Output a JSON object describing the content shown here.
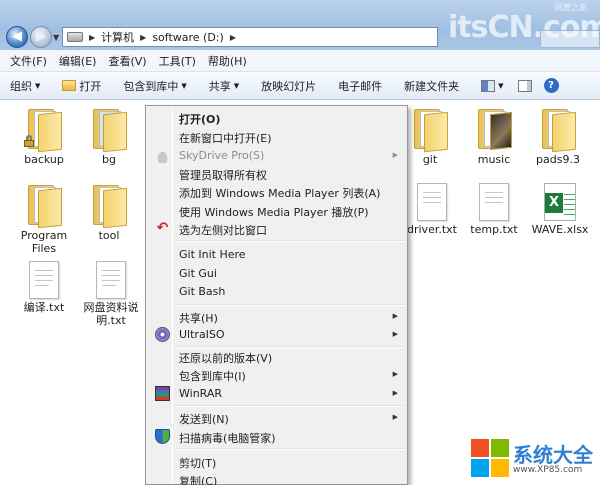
{
  "address": {
    "segments": [
      "计算机",
      "software (D:)"
    ]
  },
  "watermark": {
    "text": "itsCN.com",
    "tiny": "网管之家"
  },
  "menubar": [
    "文件(F)",
    "编辑(E)",
    "查看(V)",
    "工具(T)",
    "帮助(H)"
  ],
  "commandbar": {
    "organize": "组织",
    "open": "打开",
    "include": "包含到库中",
    "share": "共享",
    "slideshow": "放映幻灯片",
    "email": "电子邮件",
    "new_folder": "新建文件夹"
  },
  "files": [
    {
      "name": "backup",
      "type": "folder-locked"
    },
    {
      "name": "bg",
      "type": "folder"
    },
    {
      "name": "Program Files",
      "type": "folder"
    },
    {
      "name": "tool",
      "type": "folder"
    },
    {
      "name": "编译.txt",
      "type": "txt"
    },
    {
      "name": "网盘资料说明.txt",
      "type": "txt"
    },
    {
      "name": "git",
      "type": "folder"
    },
    {
      "name": "music",
      "type": "folder-music"
    },
    {
      "name": "pads9.3",
      "type": "folder"
    },
    {
      "name": "driver.txt",
      "type": "txt"
    },
    {
      "name": "temp.txt",
      "type": "txt"
    },
    {
      "name": "WAVE.xlsx",
      "type": "xlsx"
    }
  ],
  "context_menu": [
    {
      "label": "打开(O)",
      "bold": true
    },
    {
      "label": "在新窗口中打开(E)"
    },
    {
      "label": "SkyDrive Pro(S)",
      "disabled": true,
      "submenu": true,
      "icon": "cloud-icon"
    },
    {
      "label": "管理员取得所有权"
    },
    {
      "label": "添加到 Windows Media Player 列表(A)"
    },
    {
      "label": "使用 Windows Media Player 播放(P)"
    },
    {
      "label": "选为左侧对比窗口",
      "icon": "undo-arrow-icon"
    },
    {
      "label": "Git Init Here"
    },
    {
      "label": "Git Gui"
    },
    {
      "label": "Git Bash"
    },
    {
      "label": "共享(H)",
      "submenu": true
    },
    {
      "label": "UltraISO",
      "submenu": true,
      "icon": "disc-icon"
    },
    {
      "label": "还原以前的版本(V)"
    },
    {
      "label": "包含到库中(I)",
      "submenu": true
    },
    {
      "label": "WinRAR",
      "submenu": true,
      "icon": "winrar-icon"
    },
    {
      "label": "发送到(N)",
      "submenu": true
    },
    {
      "label": "扫描病毒(电脑管家)",
      "icon": "shield-icon"
    },
    {
      "label": "剪切(T)"
    },
    {
      "label": "复制(C)"
    }
  ],
  "logo": {
    "title": "系统大全",
    "url": "www.XP85.com"
  },
  "colors": {
    "ms_red": "#f25022",
    "ms_green": "#7fba00",
    "ms_blue": "#00a4ef",
    "ms_yellow": "#ffb900"
  }
}
